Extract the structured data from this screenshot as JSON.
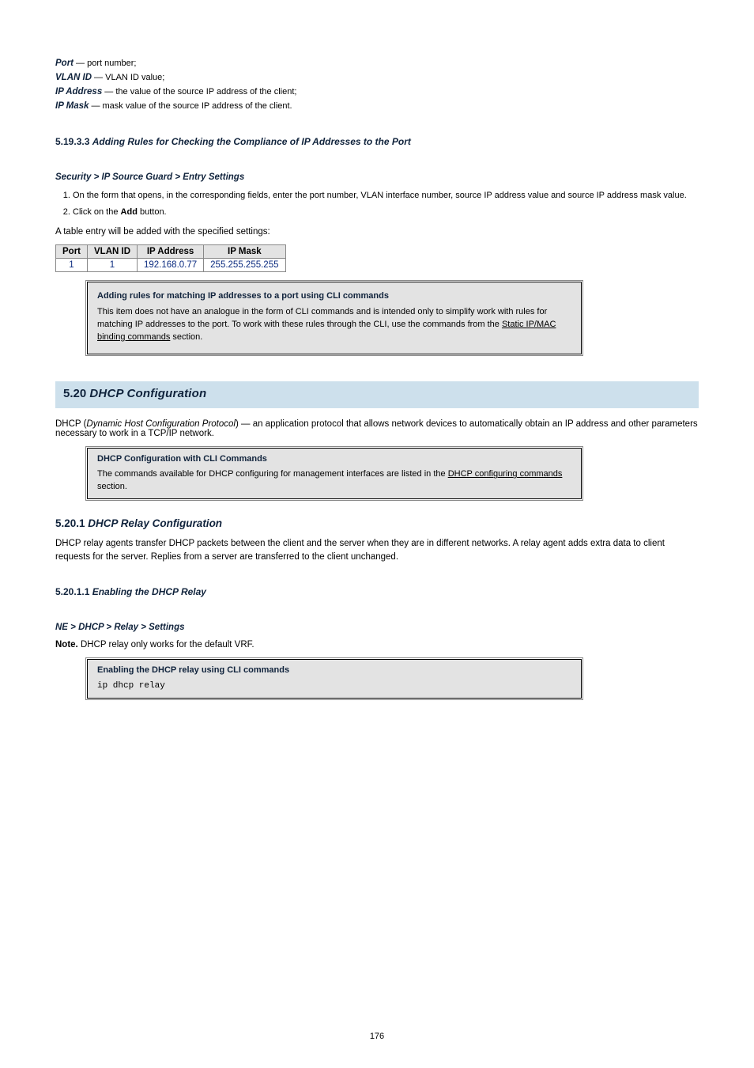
{
  "headerFields": {
    "portLabel": "Port",
    "portDesc": " — port number;",
    "vlanLabel": "VLAN ID",
    "vlanDesc": " — VLAN ID value;",
    "ipAddrLabel": "IP Address",
    "ipAddrDesc": " — the value of the source IP address of the client;",
    "ipMaskLabel": "IP Mask",
    "ipMaskDesc": " — mask value of the source IP address of the client."
  },
  "section5_19_3_3": {
    "number": "5.19.3.3 ",
    "title": "Adding Rules for Checking the Compliance of IP Addresses to the Port",
    "procedure": "Security > IP Source Guard > Entry Settings",
    "steps": [
      "On the form that opens, in the corresponding fields, enter the port number, VLAN interface number, source IP address value and source IP address mask value.",
      "Click on the "
    ],
    "addBtn": "Add",
    "step2Tail": " button.",
    "tableIntro": "A table entry will be added with the specified settings:"
  },
  "paramTable": {
    "headers": [
      "Port",
      "VLAN ID",
      "IP Address",
      "IP Mask"
    ],
    "row": [
      "1",
      "1",
      "192.168.0.77",
      "255.255.255.255"
    ]
  },
  "cliBox1": {
    "title": "Adding rules for matching IP addresses to a port using CLI commands",
    "body1": "This item does not have an analogue in the form of CLI commands and is intended only to simplify work with rules for matching IP addresses to the port. To work with these rules through the CLI, use the commands from the ",
    "linkText": "Static IP/MAC binding commands",
    "body2": " section."
  },
  "section5_20": {
    "number": "5.20 ",
    "title": "DHCP Configuration",
    "bodyPrefix": "DHCP (",
    "bodyItalic": "Dynamic Host Configuration Protocol",
    "bodySuffix": ") — an application protocol that allows network devices to automatically obtain an IP address and other parameters necessary to work in a TCP/IP network."
  },
  "cliBox2": {
    "title": "DHCP Configuration with CLI Commands",
    "body1": "The commands available for DHCP configuring for management interfaces are listed in the ",
    "linkText": "DHCP configuring commands",
    "body2": " section."
  },
  "section5_20_1": {
    "number": "5.20.1 ",
    "title": "DHCP Relay Configuration",
    "body": "DHCP relay agents transfer DHCP packets between the client and the server when they are in different networks. A relay agent adds extra data to client requests for the server. Replies from a server are transferred to the client unchanged."
  },
  "section5_20_1_1": {
    "number": "5.20.1.1 ",
    "title": "Enabling the DHCP Relay",
    "procedure": "NE > DHCP > Relay > Settings",
    "note": "Note.",
    "noteBody": " DHCP relay only works for the default VRF."
  },
  "cliBox3": {
    "title": "Enabling the DHCP relay using CLI commands",
    "code": "ip dhcp relay"
  },
  "pageNumber": "176"
}
